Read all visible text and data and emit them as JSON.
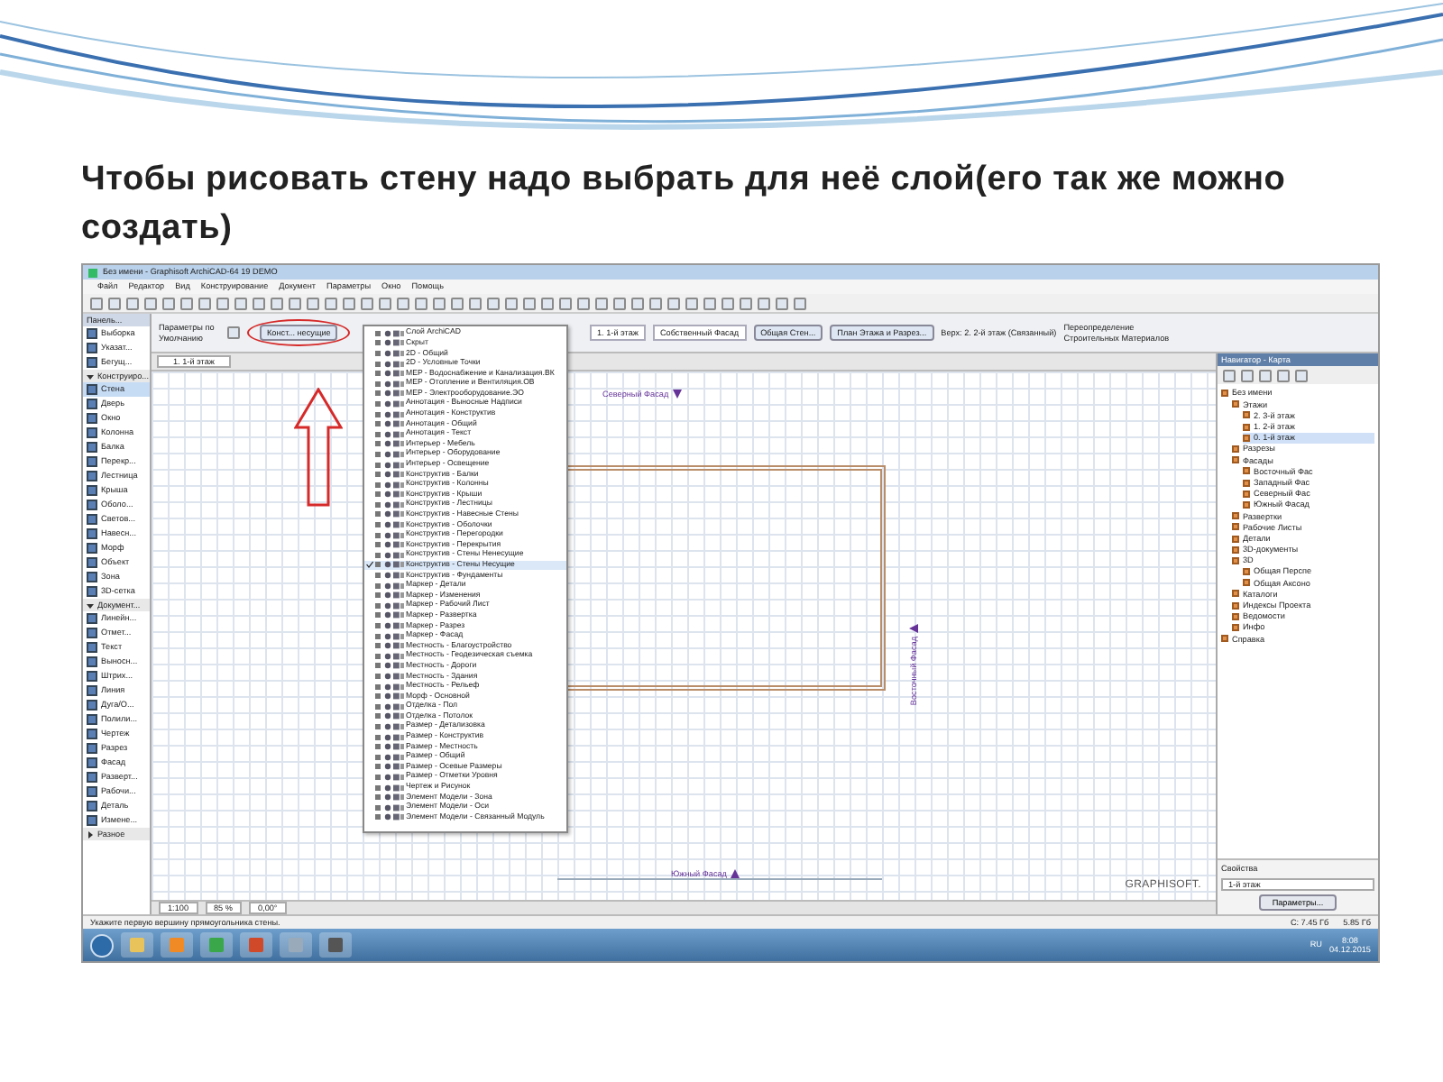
{
  "slide": {
    "title": "Чтобы рисовать стену надо выбрать для неё слой(его так же можно создать)"
  },
  "app": {
    "window_title": "Без имени - Graphisoft ArchiCAD-64 19 DEMO",
    "menu": [
      "Файл",
      "Редактор",
      "Вид",
      "Конструирование",
      "Документ",
      "Параметры",
      "Окно",
      "Помощь"
    ],
    "info_box": {
      "defaults": "Параметры по Умолчанию",
      "layer": "Конст... несущие",
      "story": "1. 1-й этаж",
      "reference": "Собственный Фасад",
      "structure": "Общая Стен...",
      "display": "План Этажа и Разрез...",
      "top": "Верх: 2. 2-й этаж (Связанный)",
      "materials": "Переопределение Строительных Материалов"
    },
    "toolbox": {
      "title": "Панель...",
      "items": [
        {
          "kind": "tool",
          "label": "Выборка",
          "selected": false
        },
        {
          "kind": "tool",
          "label": "Указат...",
          "selected": false
        },
        {
          "kind": "tool",
          "label": "Бегущ...",
          "selected": false
        },
        {
          "kind": "group",
          "label": "Конструиро...",
          "expanded": true
        },
        {
          "kind": "tool",
          "label": "Стена",
          "selected": true
        },
        {
          "kind": "tool",
          "label": "Дверь",
          "selected": false
        },
        {
          "kind": "tool",
          "label": "Окно",
          "selected": false
        },
        {
          "kind": "tool",
          "label": "Колонна",
          "selected": false
        },
        {
          "kind": "tool",
          "label": "Балка",
          "selected": false
        },
        {
          "kind": "tool",
          "label": "Перекр...",
          "selected": false
        },
        {
          "kind": "tool",
          "label": "Лестница",
          "selected": false
        },
        {
          "kind": "tool",
          "label": "Крыша",
          "selected": false
        },
        {
          "kind": "tool",
          "label": "Оболо...",
          "selected": false
        },
        {
          "kind": "tool",
          "label": "Светов...",
          "selected": false
        },
        {
          "kind": "tool",
          "label": "Навесн...",
          "selected": false
        },
        {
          "kind": "tool",
          "label": "Морф",
          "selected": false
        },
        {
          "kind": "tool",
          "label": "Объект",
          "selected": false
        },
        {
          "kind": "tool",
          "label": "Зона",
          "selected": false
        },
        {
          "kind": "tool",
          "label": "3D-сетка",
          "selected": false
        },
        {
          "kind": "group",
          "label": "Документ...",
          "expanded": true
        },
        {
          "kind": "tool",
          "label": "Линейн...",
          "selected": false
        },
        {
          "kind": "tool",
          "label": "Отмет...",
          "selected": false
        },
        {
          "kind": "tool",
          "label": "Текст",
          "selected": false
        },
        {
          "kind": "tool",
          "label": "Выносн...",
          "selected": false
        },
        {
          "kind": "tool",
          "label": "Штрих...",
          "selected": false
        },
        {
          "kind": "tool",
          "label": "Линия",
          "selected": false
        },
        {
          "kind": "tool",
          "label": "Дуга/О...",
          "selected": false
        },
        {
          "kind": "tool",
          "label": "Полили...",
          "selected": false
        },
        {
          "kind": "tool",
          "label": "Чертеж",
          "selected": false
        },
        {
          "kind": "tool",
          "label": "Разрез",
          "selected": false
        },
        {
          "kind": "tool",
          "label": "Фасад",
          "selected": false
        },
        {
          "kind": "tool",
          "label": "Разверт...",
          "selected": false
        },
        {
          "kind": "tool",
          "label": "Рабочи...",
          "selected": false
        },
        {
          "kind": "tool",
          "label": "Деталь",
          "selected": false
        },
        {
          "kind": "tool",
          "label": "Измене...",
          "selected": false
        },
        {
          "kind": "group",
          "label": "Разное",
          "expanded": false
        }
      ]
    },
    "tab": "1. 1-й этаж",
    "markers": [
      {
        "label": "Северный Фасад",
        "kind": "top"
      },
      {
        "label": "Восточный Фасад",
        "kind": "right"
      },
      {
        "label": "Южный Фасад",
        "kind": "bottom"
      }
    ],
    "layer_menu": [
      {
        "label": "Слой ArchiCAD",
        "selected": false
      },
      {
        "label": "Скрыт",
        "selected": false
      },
      {
        "label": "2D - Общий",
        "selected": false
      },
      {
        "label": "2D - Условные Точки",
        "selected": false
      },
      {
        "label": "MEP - Водоснабжение и Канализация.ВК",
        "selected": false
      },
      {
        "label": "MEP - Отопление и Вентиляция.ОВ",
        "selected": false
      },
      {
        "label": "MEP - Электрооборудование.ЭО",
        "selected": false
      },
      {
        "label": "Аннотация - Выносные Надписи",
        "selected": false
      },
      {
        "label": "Аннотация - Конструктив",
        "selected": false
      },
      {
        "label": "Аннотация - Общий",
        "selected": false
      },
      {
        "label": "Аннотация - Текст",
        "selected": false
      },
      {
        "label": "Интерьер - Мебель",
        "selected": false
      },
      {
        "label": "Интерьер - Оборудование",
        "selected": false
      },
      {
        "label": "Интерьер - Освещение",
        "selected": false
      },
      {
        "label": "Конструктив - Балки",
        "selected": false
      },
      {
        "label": "Конструктив - Колонны",
        "selected": false
      },
      {
        "label": "Конструктив - Крыши",
        "selected": false
      },
      {
        "label": "Конструктив - Лестницы",
        "selected": false
      },
      {
        "label": "Конструктив - Навесные Стены",
        "selected": false
      },
      {
        "label": "Конструктив - Оболочки",
        "selected": false
      },
      {
        "label": "Конструктив - Перегородки",
        "selected": false
      },
      {
        "label": "Конструктив - Перекрытия",
        "selected": false
      },
      {
        "label": "Конструктив - Стены Ненесущие",
        "selected": false
      },
      {
        "label": "Конструктив - Стены Несущие",
        "selected": true
      },
      {
        "label": "Конструктив - Фундаменты",
        "selected": false
      },
      {
        "label": "Маркер - Детали",
        "selected": false
      },
      {
        "label": "Маркер - Изменения",
        "selected": false
      },
      {
        "label": "Маркер - Рабочий Лист",
        "selected": false
      },
      {
        "label": "Маркер - Развертка",
        "selected": false
      },
      {
        "label": "Маркер - Разрез",
        "selected": false
      },
      {
        "label": "Маркер - Фасад",
        "selected": false
      },
      {
        "label": "Местность - Благоустройство",
        "selected": false
      },
      {
        "label": "Местность - Геодезическая съемка",
        "selected": false
      },
      {
        "label": "Местность - Дороги",
        "selected": false
      },
      {
        "label": "Местность - Здания",
        "selected": false
      },
      {
        "label": "Местность - Рельеф",
        "selected": false
      },
      {
        "label": "Морф - Основной",
        "selected": false
      },
      {
        "label": "Отделка - Пол",
        "selected": false
      },
      {
        "label": "Отделка - Потолок",
        "selected": false
      },
      {
        "label": "Размер - Детализовка",
        "selected": false
      },
      {
        "label": "Размер - Конструктив",
        "selected": false
      },
      {
        "label": "Размер - Местность",
        "selected": false
      },
      {
        "label": "Размер - Общий",
        "selected": false
      },
      {
        "label": "Размер - Осевые Размеры",
        "selected": false
      },
      {
        "label": "Размер - Отметки Уровня",
        "selected": false
      },
      {
        "label": "Чертеж и Рисунок",
        "selected": false
      },
      {
        "label": "Элемент Модели - Зона",
        "selected": false
      },
      {
        "label": "Элемент Модели - Оси",
        "selected": false
      },
      {
        "label": "Элемент Модели - Связанный Модуль",
        "selected": false
      }
    ],
    "navigator": {
      "title": "Навигатор - Карта",
      "tree": [
        {
          "label": "Без имени",
          "selected": false,
          "children": [
            {
              "label": "Этажи",
              "selected": false,
              "children": [
                {
                  "label": "2. 3-й этаж",
                  "selected": false
                },
                {
                  "label": "1. 2-й этаж",
                  "selected": false
                },
                {
                  "label": "0. 1-й этаж",
                  "selected": true
                }
              ]
            },
            {
              "label": "Разрезы",
              "selected": false
            },
            {
              "label": "Фасады",
              "selected": false,
              "children": [
                {
                  "label": "Восточный Фас",
                  "selected": false
                },
                {
                  "label": "Западный Фас",
                  "selected": false
                },
                {
                  "label": "Северный Фас",
                  "selected": false
                },
                {
                  "label": "Южный Фасад",
                  "selected": false
                }
              ]
            },
            {
              "label": "Развертки",
              "selected": false
            },
            {
              "label": "Рабочие Листы",
              "selected": false
            },
            {
              "label": "Детали",
              "selected": false
            },
            {
              "label": "3D-документы",
              "selected": false
            },
            {
              "label": "3D",
              "selected": false,
              "children": [
                {
                  "label": "Общая Перспе",
                  "selected": false
                },
                {
                  "label": "Общая Аксоно",
                  "selected": false
                }
              ]
            },
            {
              "label": "Каталоги",
              "selected": false
            },
            {
              "label": "Индексы Проекта",
              "selected": false
            },
            {
              "label": "Ведомости",
              "selected": false
            },
            {
              "label": "Инфо",
              "selected": false
            }
          ]
        },
        {
          "label": "Справка",
          "selected": false
        }
      ],
      "properties_title": "Свойства",
      "story": "1-й этаж",
      "button": "Параметры..."
    },
    "zoom_bar": {
      "scale": "1:100",
      "zoom": "85 %",
      "angle": "0,00°"
    },
    "brand": "GRAPHISOFT.",
    "status": {
      "hint": "Укажите первую вершину прямоугольника стены.",
      "disk": "С: 7.45 Гб",
      "memory": "5.85 Гб"
    },
    "taskbar": {
      "language": "RU",
      "time": "8:08",
      "date": "04.12.2015"
    }
  }
}
